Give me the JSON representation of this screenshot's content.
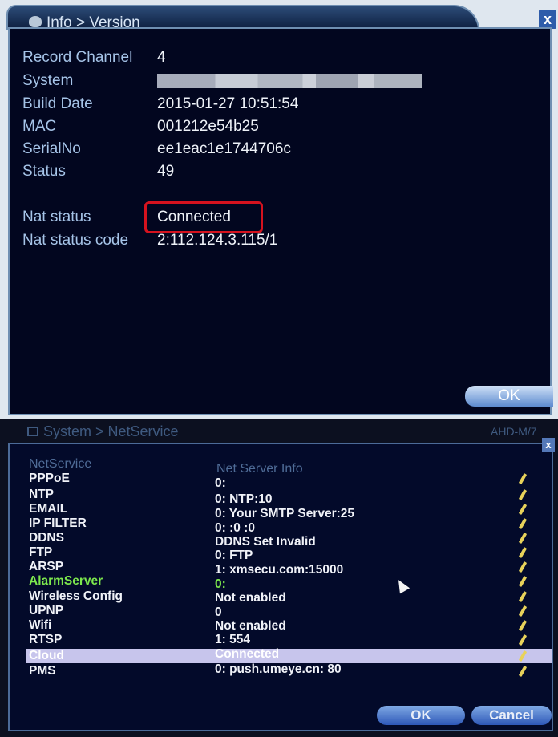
{
  "top_window": {
    "title": "Info > Version",
    "close_label": "x",
    "fields": [
      {
        "label": "Record Channel",
        "value": "4"
      },
      {
        "label": "System",
        "value": ""
      },
      {
        "label": "Build Date",
        "value": "2015-01-27 10:51:54"
      },
      {
        "label": "MAC",
        "value": "001212e54b25"
      },
      {
        "label": "SerialNo",
        "value": "ee1eac1e1744706c"
      },
      {
        "label": "Status",
        "value": "49"
      }
    ],
    "nat_status_label": "Nat status",
    "nat_status_value": "Connected",
    "nat_code_label": "Nat status code",
    "nat_code_value": "2:112.124.3.115/1",
    "ok_label": "OK"
  },
  "bottom_window": {
    "title": "System > NetService",
    "corner_text": "AHD-M/7",
    "close_label": "x",
    "col_service": "NetService",
    "col_info": "Net Server Info",
    "rows": [
      {
        "name": "PPPoE",
        "info": "0:"
      },
      {
        "name": "NTP",
        "info": "0: NTP:10"
      },
      {
        "name": "EMAIL",
        "info": "0: Your SMTP Server:25"
      },
      {
        "name": "IP FILTER",
        "info": "0: :0 :0"
      },
      {
        "name": "DDNS",
        "info": "DDNS Set Invalid"
      },
      {
        "name": "FTP",
        "info": "0: FTP"
      },
      {
        "name": "ARSP",
        "info": "1: xmsecu.com:15000"
      },
      {
        "name": "AlarmServer",
        "info": "0:"
      },
      {
        "name": "Wireless Config",
        "info": "Not enabled"
      },
      {
        "name": "UPNP",
        "info": "0"
      },
      {
        "name": "Wifi",
        "info": "Not enabled"
      },
      {
        "name": "RTSP",
        "info": "1: 554"
      },
      {
        "name": "Cloud",
        "info": "Connected"
      },
      {
        "name": "PMS",
        "info": "0: push.umeye.cn: 80"
      }
    ],
    "ok_label": "OK",
    "cancel_label": "Cancel",
    "colors": {
      "alarm_row": "#7de84d",
      "selected_row": "#c7c5ec",
      "edit_icon": "#e8d25a"
    }
  }
}
